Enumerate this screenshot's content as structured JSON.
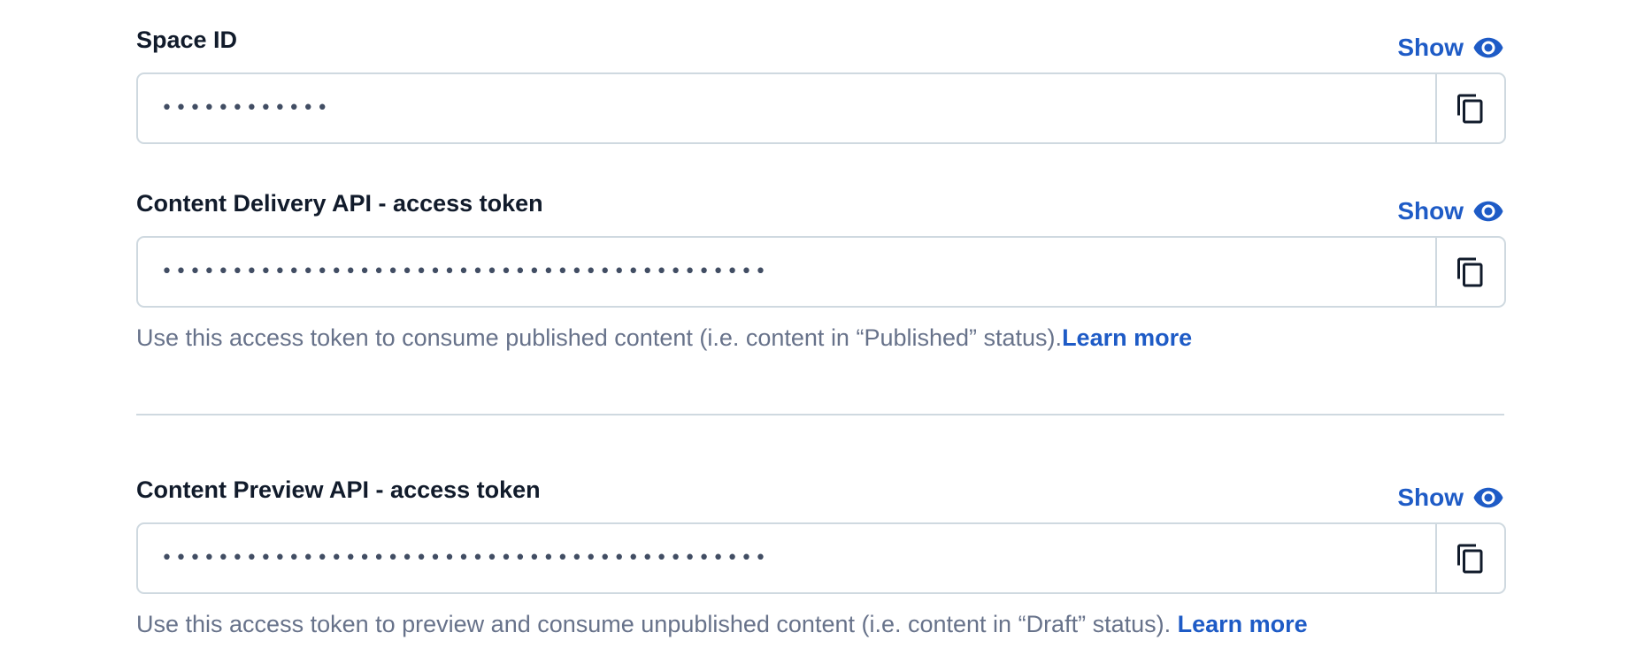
{
  "space_id": {
    "label": "Space ID",
    "show_label": "Show",
    "masked_value": "••••••••••••",
    "copy_icon": "copy-icon",
    "show_icon": "eye-icon"
  },
  "delivery_token": {
    "label": "Content Delivery API - access token",
    "show_label": "Show",
    "masked_value": "•••••••••••••••••••••••••••••••••••••••••••",
    "help_text": "Use this access token to consume published content (i.e. content in “Published” status).",
    "learn_more": "Learn more",
    "copy_icon": "copy-icon",
    "show_icon": "eye-icon"
  },
  "preview_token": {
    "label": "Content Preview API - access token",
    "show_label": "Show",
    "masked_value": "•••••••••••••••••••••••••••••••••••••••••••",
    "help_text": "Use this access token to preview and consume unpublished content (i.e. content in “Draft” status). ",
    "learn_more": "Learn more",
    "copy_icon": "copy-icon",
    "show_icon": "eye-icon"
  },
  "colors": {
    "link": "#1e5bc6",
    "label": "#111b2b",
    "help_text": "#67728a",
    "border": "#cfd9e0"
  }
}
